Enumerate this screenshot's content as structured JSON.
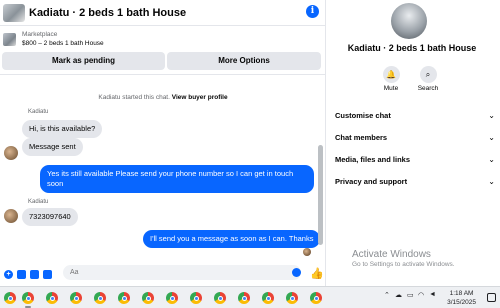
{
  "header": {
    "title": "Kadiatu · 2 beds 1 bath House",
    "info_icon": "info-icon"
  },
  "listing": {
    "label": "Marketplace",
    "price_title": "$800 – 2 beds 1 bath House"
  },
  "actions": {
    "mark_pending": "Mark as pending",
    "more_options": "More Options"
  },
  "system_message": {
    "text": "Kadiatu started this chat. ",
    "link": "View buyer profile"
  },
  "messages": [
    {
      "sender": "Kadiatu",
      "text": "Hi, is this available?",
      "direction": "incoming"
    },
    {
      "text": "Message sent",
      "direction": "incoming"
    },
    {
      "text": "Yes its still available Please send your phone number so I can get in touch soon",
      "direction": "outgoing"
    },
    {
      "sender": "Kadiatu",
      "text": "7323097640",
      "direction": "incoming"
    },
    {
      "text": "I'll send you a message as soon as I can. Thanks",
      "direction": "outgoing"
    }
  ],
  "composer": {
    "placeholder": "Aa",
    "icons": [
      "add-icon",
      "gif-icon",
      "sticker-icon",
      "image-icon",
      "emoji-icon",
      "thumbs-up-icon"
    ]
  },
  "panel": {
    "title": "Kadiatu · 2 beds 1 bath House",
    "mute_label": "Mute",
    "search_label": "Search",
    "sections": [
      "Customise chat",
      "Chat members",
      "Media, files and links",
      "Privacy and support"
    ]
  },
  "watermark": {
    "title": "Activate Windows",
    "subtitle": "Go to Settings to activate Windows."
  },
  "taskbar": {
    "time": "1:18 AM",
    "date": "3/15/2025",
    "app_icon": "chrome-icon"
  },
  "colors": {
    "accent": "#0866ff",
    "bubble_in": "#e4e6eb",
    "text": "#050505"
  }
}
